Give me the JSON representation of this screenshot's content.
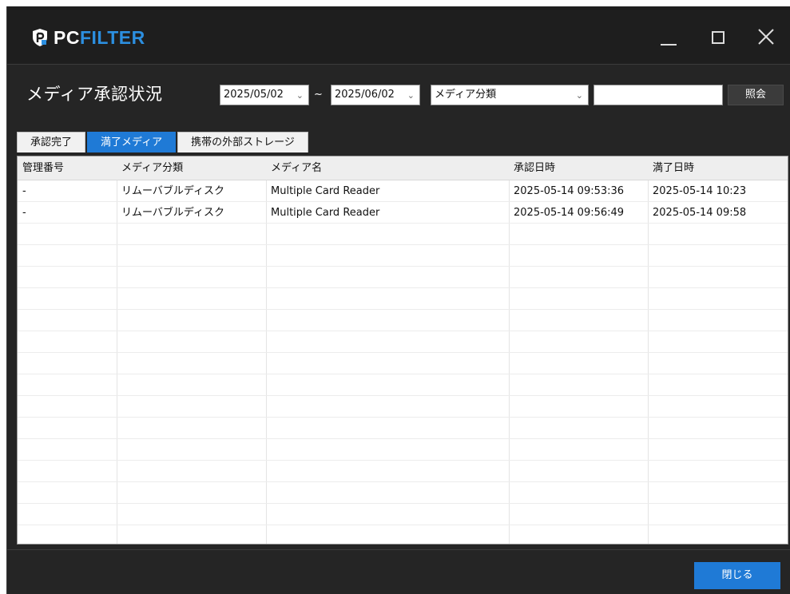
{
  "app": {
    "logo_text_pc": "PC",
    "logo_text_filter": "FILTER",
    "accent_color": "#2c8fe0",
    "active_tab_color": "#1f7ad6"
  },
  "header": {
    "title": "メディア承認状況",
    "date_from": "2025/05/02",
    "range_separator": "~",
    "date_to": "2025/06/02",
    "media_type_selected": "メディア分類",
    "search_value": "",
    "query_button": "照会"
  },
  "tabs": [
    {
      "label": "承認完了",
      "active": false
    },
    {
      "label": "満了メディア",
      "active": true
    },
    {
      "label": "携帯の外部ストレージ",
      "active": false
    }
  ],
  "table": {
    "columns": [
      "管理番号",
      "メディア分類",
      "メディア名",
      "承認日時",
      "満了日時"
    ],
    "rows": [
      [
        "-",
        "リムーバブルディスク",
        "Multiple Card Reader",
        "2025-05-14 09:53:36",
        "2025-05-14 10:23"
      ],
      [
        "-",
        "リムーバブルディスク",
        "Multiple Card Reader",
        "2025-05-14 09:56:49",
        "2025-05-14 09:58"
      ]
    ]
  },
  "footer": {
    "close_button": "閉じる"
  },
  "icons": {
    "logo": "shield-logo-icon",
    "minimize": "minimize-icon",
    "maximize": "maximize-icon",
    "close": "close-icon",
    "dropdown": "chevron-down-icon"
  }
}
